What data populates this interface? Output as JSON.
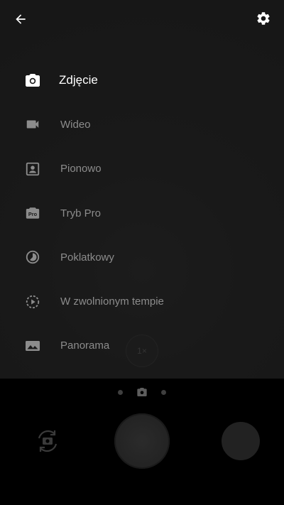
{
  "top_bar": {
    "back_icon": "arrow-left-icon",
    "settings_icon": "gear-icon"
  },
  "viewfinder": {
    "zoom_label": "1×"
  },
  "modes": [
    {
      "id": "photo",
      "label": "Zdjęcie",
      "icon": "camera-icon",
      "active": true
    },
    {
      "id": "video",
      "label": "Wideo",
      "icon": "video-camera-icon",
      "active": false
    },
    {
      "id": "portrait",
      "label": "Pionowo",
      "icon": "portrait-icon",
      "active": false
    },
    {
      "id": "pro",
      "label": "Tryb Pro",
      "icon": "pro-mode-icon",
      "icon_text": "Pro",
      "active": false
    },
    {
      "id": "timelapse",
      "label": "Poklatkowy",
      "icon": "timelapse-icon",
      "active": false
    },
    {
      "id": "slowmo",
      "label": "W zwolnionym tempie",
      "icon": "slow-motion-icon",
      "active": false
    },
    {
      "id": "panorama",
      "label": "Panorama",
      "icon": "panorama-icon",
      "active": false
    }
  ],
  "colors": {
    "active_text": "#ffffff",
    "inactive_text": "#8c8c8c",
    "background": "#000000"
  }
}
